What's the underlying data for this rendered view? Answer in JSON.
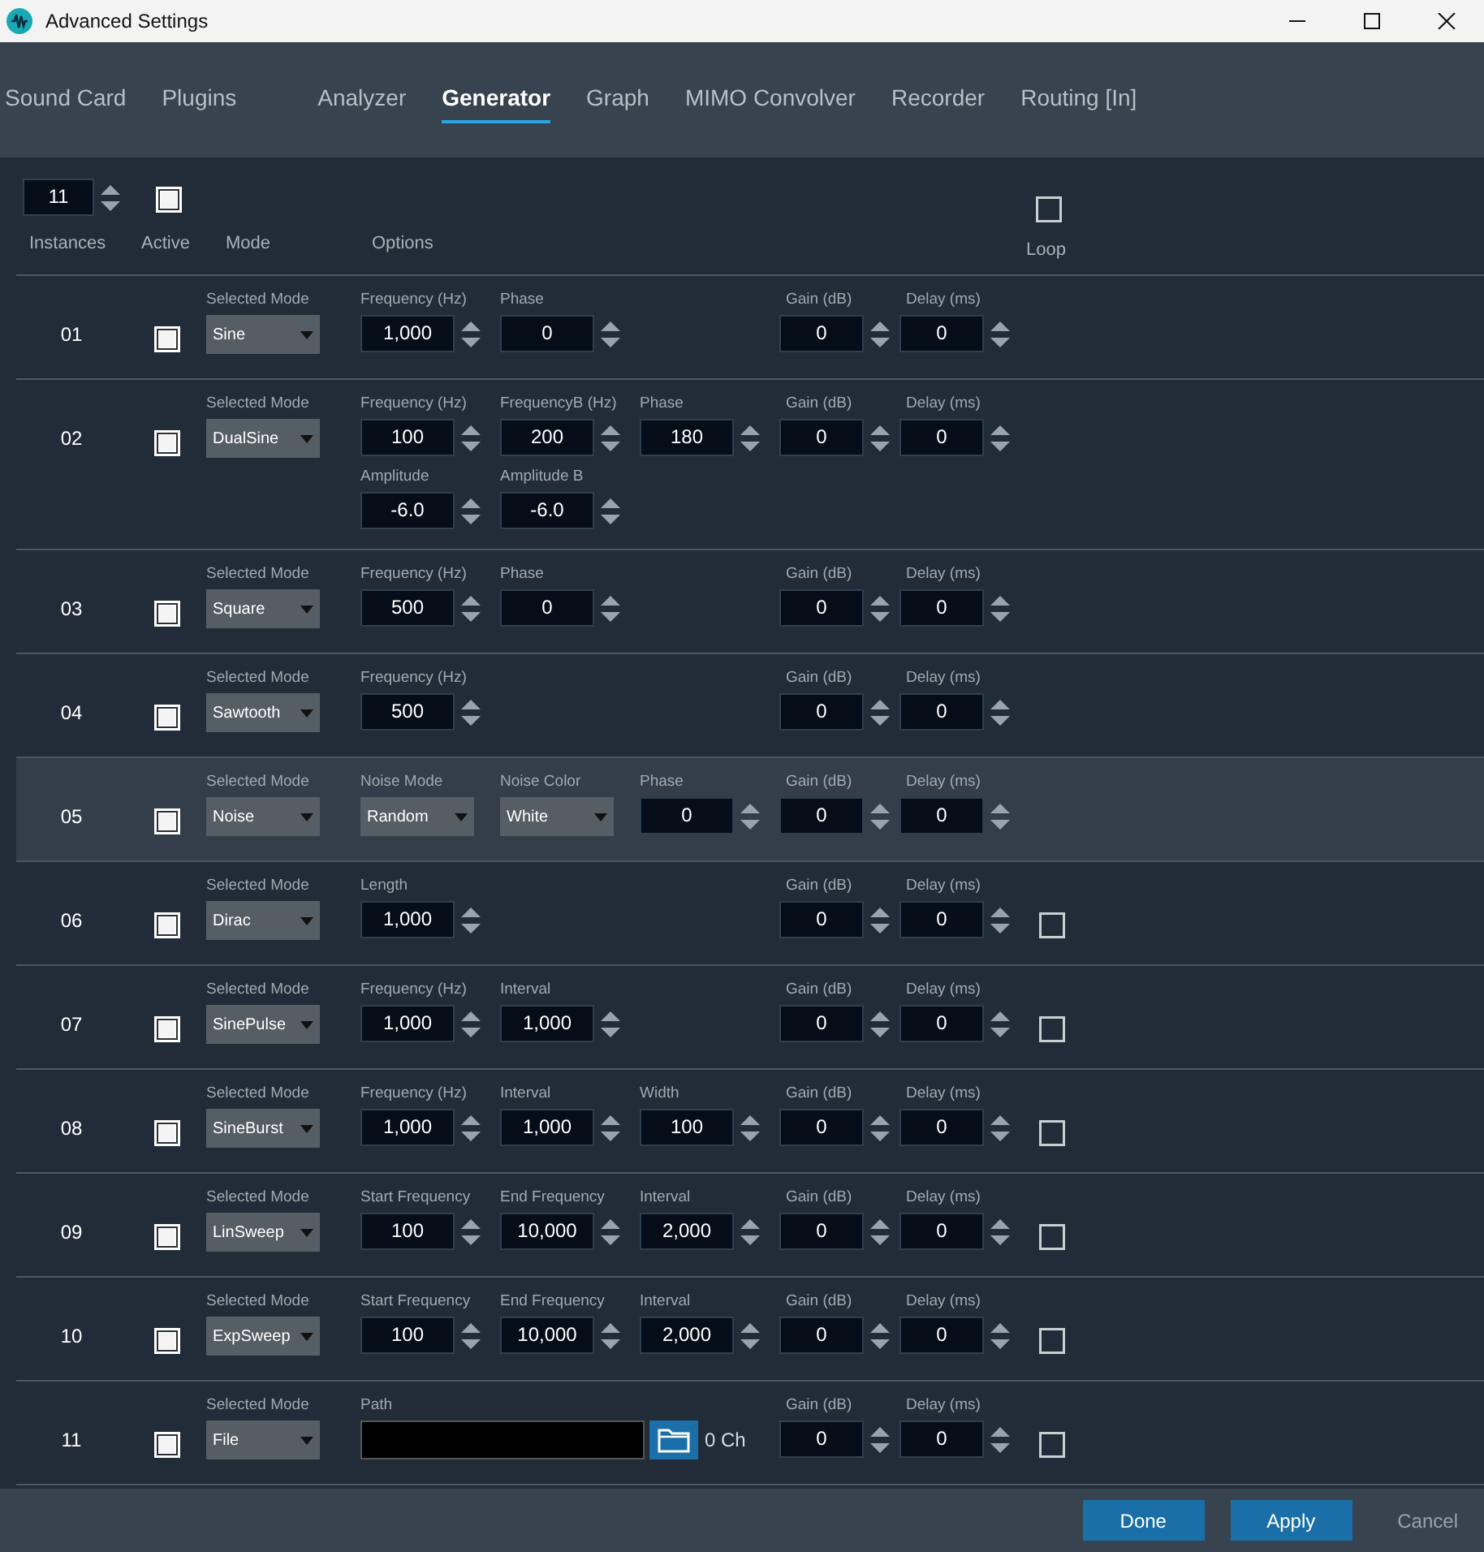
{
  "window": {
    "title": "Advanced Settings"
  },
  "tabs": [
    {
      "label": "Sound Card",
      "selected": false
    },
    {
      "label": "Plugins",
      "selected": false
    },
    {
      "label": "Analyzer",
      "selected": false
    },
    {
      "label": "Generator",
      "selected": true
    },
    {
      "label": "Graph",
      "selected": false
    },
    {
      "label": "MIMO Convolver",
      "selected": false
    },
    {
      "label": "Recorder",
      "selected": false
    },
    {
      "label": "Routing [In]",
      "selected": false
    }
  ],
  "header": {
    "instances_value": "11",
    "active_checked": true,
    "loop_checked": false,
    "labels": [
      "Instances",
      "Active",
      "Mode",
      "Options"
    ],
    "loop_label": "Loop"
  },
  "instances": [
    {
      "number": "01",
      "selected": false,
      "active": true,
      "mode_label": "Selected Mode",
      "mode": "Sine",
      "options": [
        {
          "kind": "number",
          "label": "Frequency (Hz)",
          "value": "1,000"
        },
        {
          "kind": "number",
          "label": "Phase",
          "value": "0"
        }
      ],
      "gain_label": "Gain (dB)",
      "gain": "0",
      "delay_label": "Delay (ms)",
      "delay": "0"
    },
    {
      "number": "02",
      "selected": false,
      "active": true,
      "mode_label": "Selected Mode",
      "mode": "DualSine",
      "options": [
        {
          "kind": "number",
          "label": "Frequency (Hz)",
          "value": "100"
        },
        {
          "kind": "number",
          "label": "FrequencyB (Hz)",
          "value": "200"
        },
        {
          "kind": "number",
          "label": "Phase",
          "value": "180"
        },
        {
          "kind": "number",
          "label": "Amplitude",
          "value": "-6.0"
        },
        {
          "kind": "number",
          "label": "Amplitude B",
          "value": "-6.0"
        }
      ],
      "gain_label": "Gain (dB)",
      "gain": "0",
      "delay_label": "Delay (ms)",
      "delay": "0"
    },
    {
      "number": "03",
      "selected": false,
      "active": true,
      "mode_label": "Selected Mode",
      "mode": "Square",
      "options": [
        {
          "kind": "number",
          "label": "Frequency (Hz)",
          "value": "500"
        },
        {
          "kind": "number",
          "label": "Phase",
          "value": "0"
        }
      ],
      "gain_label": "Gain (dB)",
      "gain": "0",
      "delay_label": "Delay (ms)",
      "delay": "0"
    },
    {
      "number": "04",
      "selected": false,
      "active": true,
      "mode_label": "Selected Mode",
      "mode": "Sawtooth",
      "options": [
        {
          "kind": "number",
          "label": "Frequency (Hz)",
          "value": "500"
        }
      ],
      "gain_label": "Gain (dB)",
      "gain": "0",
      "delay_label": "Delay (ms)",
      "delay": "0"
    },
    {
      "number": "05",
      "selected": true,
      "active": true,
      "mode_label": "Selected Mode",
      "mode": "Noise",
      "options": [
        {
          "kind": "select",
          "label": "Noise Mode",
          "value": "Random"
        },
        {
          "kind": "select",
          "label": "Noise Color",
          "value": "White"
        },
        {
          "kind": "number",
          "label": "Phase",
          "value": "0"
        }
      ],
      "gain_label": "Gain (dB)",
      "gain": "0",
      "delay_label": "Delay (ms)",
      "delay": "0"
    },
    {
      "number": "06",
      "selected": false,
      "active": true,
      "mode_label": "Selected Mode",
      "mode": "Dirac",
      "options": [
        {
          "kind": "number",
          "label": "Length",
          "value": "1,000"
        }
      ],
      "gain_label": "Gain (dB)",
      "gain": "0",
      "delay_label": "Delay (ms)",
      "delay": "0",
      "loop": false
    },
    {
      "number": "07",
      "selected": false,
      "active": true,
      "mode_label": "Selected Mode",
      "mode": "SinePulse",
      "options": [
        {
          "kind": "number",
          "label": "Frequency (Hz)",
          "value": "1,000"
        },
        {
          "kind": "number",
          "label": "Interval",
          "value": "1,000"
        }
      ],
      "gain_label": "Gain (dB)",
      "gain": "0",
      "delay_label": "Delay (ms)",
      "delay": "0",
      "loop": false
    },
    {
      "number": "08",
      "selected": false,
      "active": true,
      "mode_label": "Selected Mode",
      "mode": "SineBurst",
      "options": [
        {
          "kind": "number",
          "label": "Frequency (Hz)",
          "value": "1,000"
        },
        {
          "kind": "number",
          "label": "Interval",
          "value": "1,000"
        },
        {
          "kind": "number",
          "label": "Width",
          "value": "100"
        }
      ],
      "gain_label": "Gain (dB)",
      "gain": "0",
      "delay_label": "Delay (ms)",
      "delay": "0",
      "loop": false
    },
    {
      "number": "09",
      "selected": false,
      "active": true,
      "mode_label": "Selected Mode",
      "mode": "LinSweep",
      "options": [
        {
          "kind": "number",
          "label": "Start Frequency",
          "value": "100"
        },
        {
          "kind": "number",
          "label": "End Frequency",
          "value": "10,000"
        },
        {
          "kind": "number",
          "label": "Interval",
          "value": "2,000"
        }
      ],
      "gain_label": "Gain (dB)",
      "gain": "0",
      "delay_label": "Delay (ms)",
      "delay": "0",
      "loop": false
    },
    {
      "number": "10",
      "selected": false,
      "active": true,
      "mode_label": "Selected Mode",
      "mode": "ExpSweep",
      "options": [
        {
          "kind": "number",
          "label": "Start Frequency",
          "value": "100"
        },
        {
          "kind": "number",
          "label": "End Frequency",
          "value": "10,000"
        },
        {
          "kind": "number",
          "label": "Interval",
          "value": "2,000"
        }
      ],
      "gain_label": "Gain (dB)",
      "gain": "0",
      "delay_label": "Delay (ms)",
      "delay": "0",
      "loop": false
    },
    {
      "number": "11",
      "selected": false,
      "active": true,
      "mode_label": "Selected Mode",
      "mode": "File",
      "options": [
        {
          "kind": "path",
          "label": "Path",
          "channels": "0 Ch"
        }
      ],
      "gain_label": "Gain (dB)",
      "gain": "0",
      "delay_label": "Delay (ms)",
      "delay": "0",
      "loop": false
    }
  ],
  "footer": [
    {
      "label": "Done",
      "kind": "primary"
    },
    {
      "label": "Apply",
      "kind": "primary"
    },
    {
      "label": "Cancel",
      "kind": "link"
    }
  ]
}
